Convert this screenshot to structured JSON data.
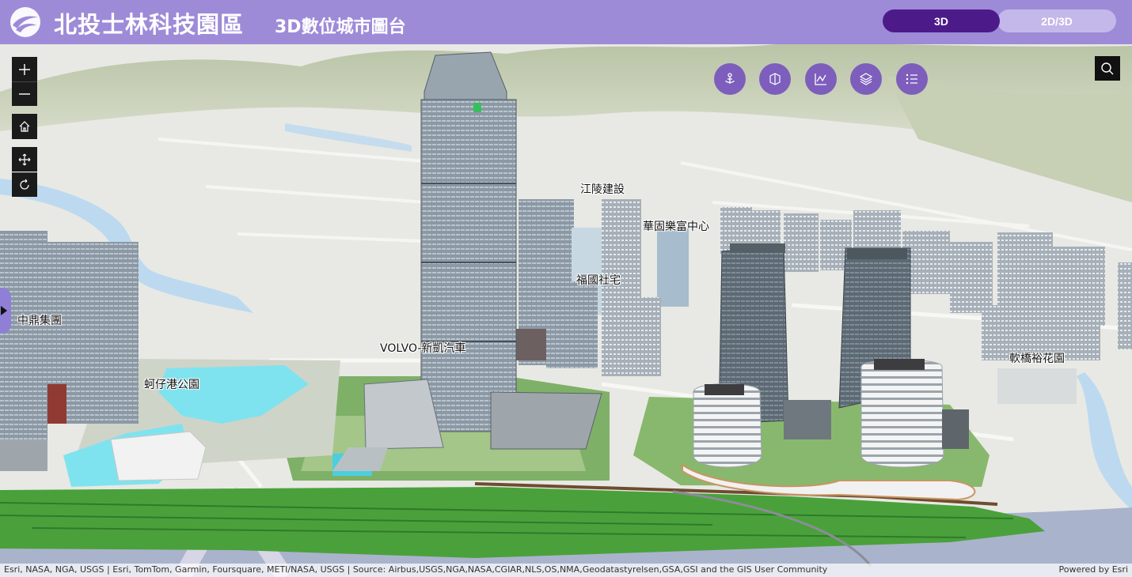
{
  "header": {
    "title": "北投士林科技園區",
    "subtitle": "3D數位城市圖台",
    "modes": [
      {
        "label": "3D",
        "active": true
      },
      {
        "label": "2D/3D",
        "active": false
      }
    ]
  },
  "controls": {
    "zoom_in": "+",
    "zoom_out": "−",
    "icons": [
      "plus-icon",
      "minus-icon",
      "home-icon",
      "pan-icon",
      "rotate-icon",
      "search-icon",
      "expand-arrow-icon"
    ]
  },
  "toolbar": {
    "tools": [
      {
        "name": "anchor-icon"
      },
      {
        "name": "cube-icon"
      },
      {
        "name": "chart-icon"
      },
      {
        "name": "layers-icon"
      },
      {
        "name": "list-icon"
      }
    ]
  },
  "map": {
    "labels": [
      "江陵建設",
      "華固樂富中心",
      "福國社宅",
      "中鼎集團",
      "VOLVO-新凱汽車",
      "蚵仔港公園",
      "軟橋裕花園"
    ]
  },
  "attribution": {
    "left": "Esri, NASA, NGA, USGS | Esri, TomTom, Garmin, Foursquare, METI/NASA, USGS | Source: Airbus,USGS,NGA,NASA,CGIAR,NLS,OS,NMA,Geodatastyrelsen,GSA,GSI and the GIS User Community",
    "right": "Powered by Esri"
  },
  "colors": {
    "header_bg": "#9d8bd8",
    "mode_active": "#4d1a8a",
    "mode_inactive": "#c4b8ea",
    "tool_button": "#7d5ebc"
  }
}
